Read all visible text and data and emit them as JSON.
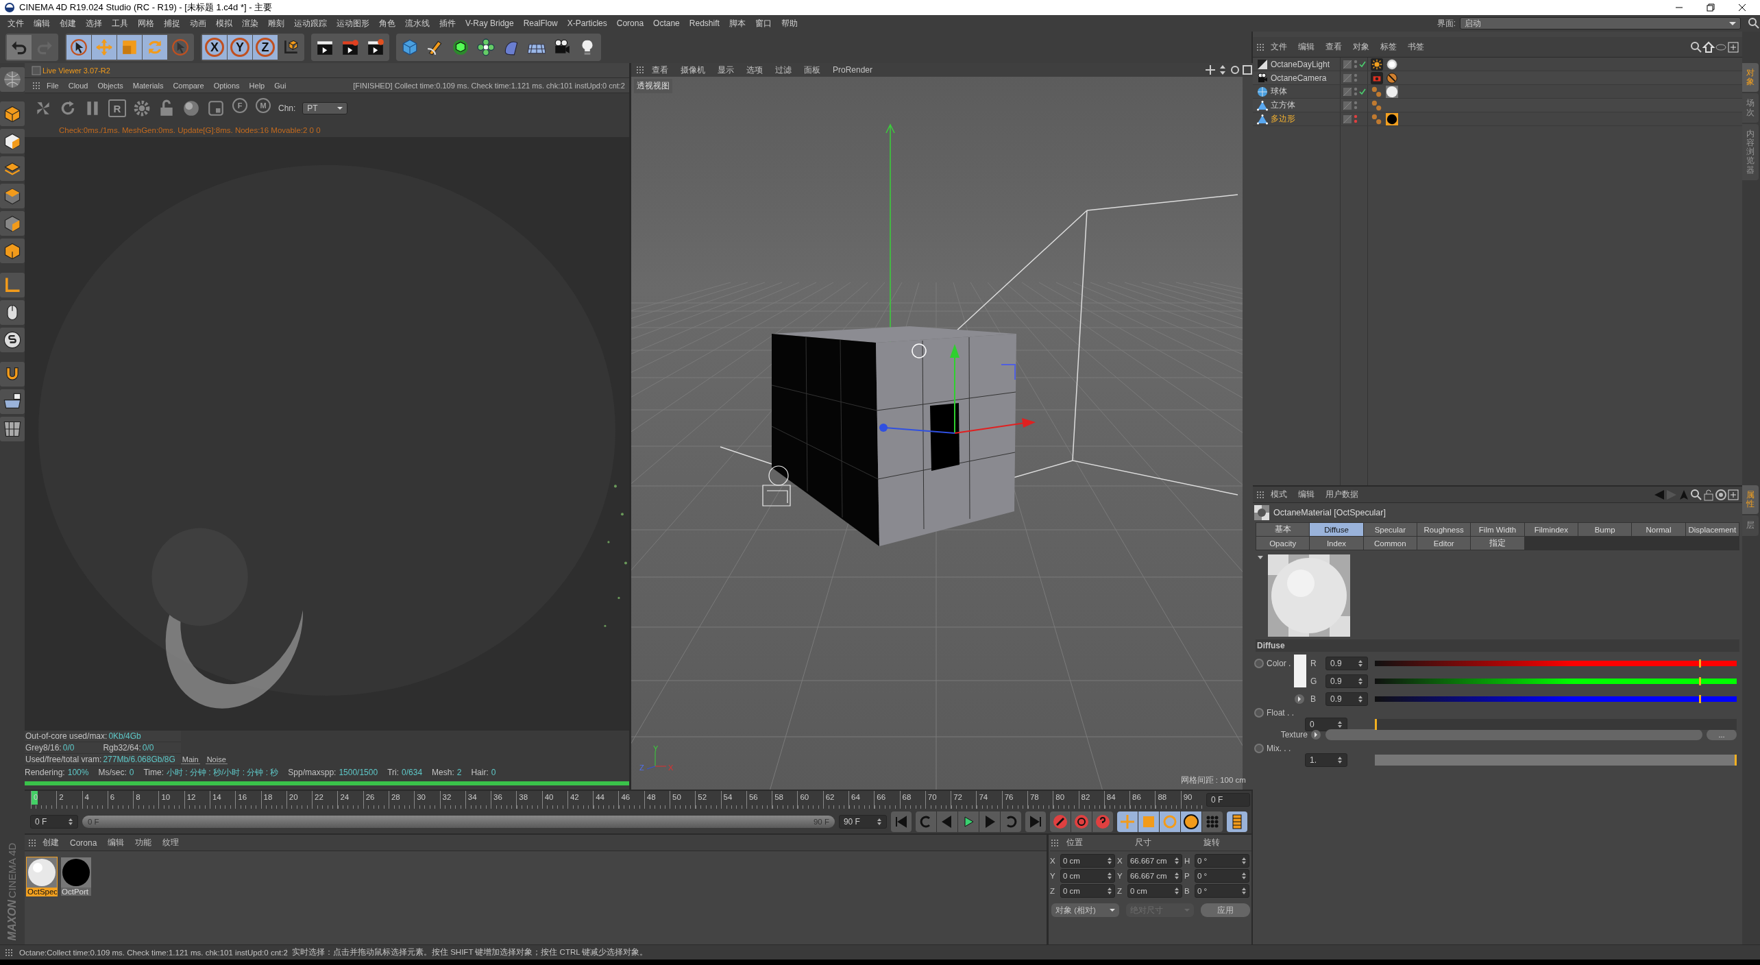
{
  "window": {
    "title": "CINEMA 4D R19.024 Studio (RC - R19) - [未标题 1.c4d *] - 主要"
  },
  "menu_bar": {
    "items": [
      "文件",
      "编辑",
      "创建",
      "选择",
      "工具",
      "网格",
      "捕捉",
      "动画",
      "模拟",
      "渲染",
      "雕刻",
      "运动跟踪",
      "运动图形",
      "角色",
      "流水线",
      "插件",
      "V-Ray Bridge",
      "RealFlow",
      "X-Particles",
      "Corona",
      "Octane",
      "Redshift",
      "脚本",
      "窗口",
      "帮助"
    ],
    "layout_label": "界面:",
    "layout_value": "启动"
  },
  "toolbar": {
    "axis_labels": [
      "X",
      "Y",
      "Z"
    ]
  },
  "live_viewer": {
    "title": "Live Viewer 3.07-R2",
    "menus": [
      "File",
      "Cloud",
      "Objects",
      "Materials",
      "Compare",
      "Options",
      "Help",
      "Gui"
    ],
    "status": "[FINISHED] Collect time:0.109 ms.  Check time:1.121 ms.  chk:101  instUpd:0  cnt:2",
    "icon_letters": [
      "R",
      "F",
      "M"
    ],
    "channel_label": "Chn:",
    "channel_value": "PT",
    "info": "Check:0ms./1ms. MeshGen:0ms. Update[G]:8ms. Nodes:16 Movable:2  0 0",
    "stats": [
      [
        {
          "label": "Out-of-core used/max:",
          "value": "0Kb/4Gb"
        }
      ],
      [
        {
          "label": "Grey8/16:",
          "value": "0/0"
        },
        {
          "label": "Rgb32/64:",
          "value": "0/0"
        }
      ],
      [
        {
          "label": "Used/free/total vram:",
          "value": "277Mb/6.068Gb/8G"
        }
      ]
    ],
    "view_tabs": [
      "Main",
      "Noise"
    ],
    "render_stats": [
      {
        "label": "Rendering:",
        "value": "100%"
      },
      {
        "label": "Ms/sec:",
        "value": "0"
      },
      {
        "label": "Time:",
        "value": "小时 : 分钟 : 秒/小时 : 分钟 : 秒"
      },
      {
        "label": "Spp/maxspp:",
        "value": "1500/1500"
      },
      {
        "label": "Tri:",
        "value": "0/634"
      },
      {
        "label": "Mesh:",
        "value": "2"
      },
      {
        "label": "Hair:",
        "value": "0"
      }
    ],
    "progress": {
      "level": 1
    }
  },
  "viewport": {
    "menus": [
      "查看",
      "摄像机",
      "显示",
      "选项",
      "过滤",
      "面板",
      "ProRender"
    ],
    "view_name": "透视视图",
    "grid_spacing": "网格间距 : 100 cm",
    "axis_labels": [
      "Y",
      "Z",
      "X"
    ]
  },
  "timeline": {
    "ticks": [
      "0",
      "2",
      "4",
      "6",
      "8",
      "10",
      "12",
      "14",
      "16",
      "18",
      "20",
      "22",
      "24",
      "26",
      "28",
      "30",
      "32",
      "34",
      "36",
      "38",
      "40",
      "42",
      "44",
      "46",
      "48",
      "50",
      "52",
      "54",
      "56",
      "58",
      "60",
      "62",
      "64",
      "66",
      "68",
      "70",
      "72",
      "74",
      "76",
      "78",
      "80",
      "82",
      "84",
      "86",
      "88",
      "90"
    ],
    "end_field": "0 F"
  },
  "transport": {
    "start_field": "0 F",
    "range": {
      "start": "0 F",
      "end": "90 F"
    },
    "end_field": "90 F"
  },
  "materials": {
    "menus": [
      "创建",
      "Corona",
      "编辑",
      "功能",
      "纹理"
    ],
    "items": [
      {
        "name": "OctSpec",
        "kind": "white",
        "selected": true
      },
      {
        "name": "OctPort",
        "kind": "black",
        "selected": false
      }
    ]
  },
  "coordinates": {
    "headers": [
      "位置",
      "尺寸",
      "旋转"
    ],
    "rows": [
      {
        "axes": [
          "X",
          "X",
          "H"
        ],
        "values": [
          "0 cm",
          "66.667 cm",
          "0 °"
        ]
      },
      {
        "axes": [
          "Y",
          "Y",
          "P"
        ],
        "values": [
          "0 cm",
          "66.667 cm",
          "0 °"
        ]
      },
      {
        "axes": [
          "Z",
          "Z",
          "B"
        ],
        "values": [
          "0 cm",
          "0 cm",
          "0 °"
        ]
      }
    ],
    "mode_dropdown": "对象 (相对)",
    "size_dropdown": {
      "label": "绝对尺寸",
      "disabled": true
    },
    "apply": "应用"
  },
  "logo": {
    "lines": [
      "MAXON",
      "CINEMA 4D"
    ]
  },
  "objects": {
    "menus": [
      "文件",
      "编辑",
      "查看",
      "对象",
      "标签",
      "书签"
    ],
    "rows": [
      {
        "name": "OctaneDayLight",
        "kind": "light",
        "selected": false,
        "enabled": true,
        "hidden": false,
        "tags": [
          {
            "kind": "sun"
          },
          {
            "kind": "sky"
          }
        ]
      },
      {
        "name": "OctaneCamera",
        "kind": "camera",
        "selected": false,
        "enabled": false,
        "hidden": false,
        "tags": [
          {
            "kind": "camera"
          },
          {
            "kind": "forbid"
          }
        ]
      },
      {
        "name": "球体",
        "kind": "sphere",
        "selected": false,
        "enabled": true,
        "hidden": false,
        "tags": [
          {
            "kind": "phong"
          },
          {
            "kind": "white"
          }
        ]
      },
      {
        "name": "立方体",
        "kind": "polygon",
        "selected": false,
        "enabled": false,
        "hidden": false,
        "tags": [
          {
            "kind": "phong"
          }
        ]
      },
      {
        "name": "多边形",
        "kind": "polygon",
        "selected": true,
        "enabled": false,
        "hidden": true,
        "tags": [
          {
            "kind": "phong"
          },
          {
            "kind": "black"
          }
        ]
      }
    ]
  },
  "attributes": {
    "menus": [
      "模式",
      "编辑",
      "用户数据"
    ],
    "title": "OctaneMaterial [OctSpecular]",
    "tabs": [
      {
        "label": "基本",
        "selected": false
      },
      {
        "label": "Diffuse",
        "selected": true
      },
      {
        "label": "Specular",
        "selected": false
      },
      {
        "label": "Roughness",
        "selected": false
      },
      {
        "label": "Film Width",
        "selected": false
      },
      {
        "label": "Filmindex",
        "selected": false
      },
      {
        "label": "Bump",
        "selected": false
      },
      {
        "label": "Normal",
        "selected": false
      },
      {
        "label": "Displacement",
        "selected": false
      },
      {
        "label": "Opacity",
        "selected": false
      },
      {
        "label": "Index",
        "selected": false
      },
      {
        "label": "Common",
        "selected": false
      },
      {
        "label": "Editor",
        "selected": false
      },
      {
        "label": "指定",
        "selected": false
      }
    ],
    "section": "Diffuse",
    "color_label": "Color .",
    "color_keyframe": false,
    "channels": [
      {
        "name": "R",
        "value": "0.9",
        "level": 0.9,
        "color": "#ff0000"
      },
      {
        "name": "G",
        "value": "0.9",
        "level": 0.9,
        "color": "#00ff00"
      },
      {
        "name": "B",
        "value": "0.9",
        "level": 0.9,
        "color": "#0000ff"
      }
    ],
    "float": {
      "label": "Float . .",
      "value": "0",
      "level": 0,
      "keyframe": false
    },
    "texture": {
      "label": "Texture",
      "button": "..."
    },
    "mix": {
      "label": "Mix. . .",
      "value": "1.",
      "level": 1,
      "keyframe": false
    }
  },
  "side_tabs_top": [
    {
      "label": "对象",
      "selected": true
    },
    {
      "label": "场次",
      "selected": false
    },
    {
      "label": "内容浏览器",
      "selected": false
    }
  ],
  "side_tabs_bottom": [
    {
      "label": "属性",
      "selected": true
    },
    {
      "label": "层",
      "selected": false
    }
  ],
  "status_bar": {
    "left": "Octane:Collect time:0.109 ms.  Check time:1.121 ms.  chk:101  instUpd:0  cnt:2",
    "right": "实时选择：点击并拖动鼠标选择元素。按住 SHIFT 键增加选择对象；按住 CTRL 键减少选择对象。"
  }
}
